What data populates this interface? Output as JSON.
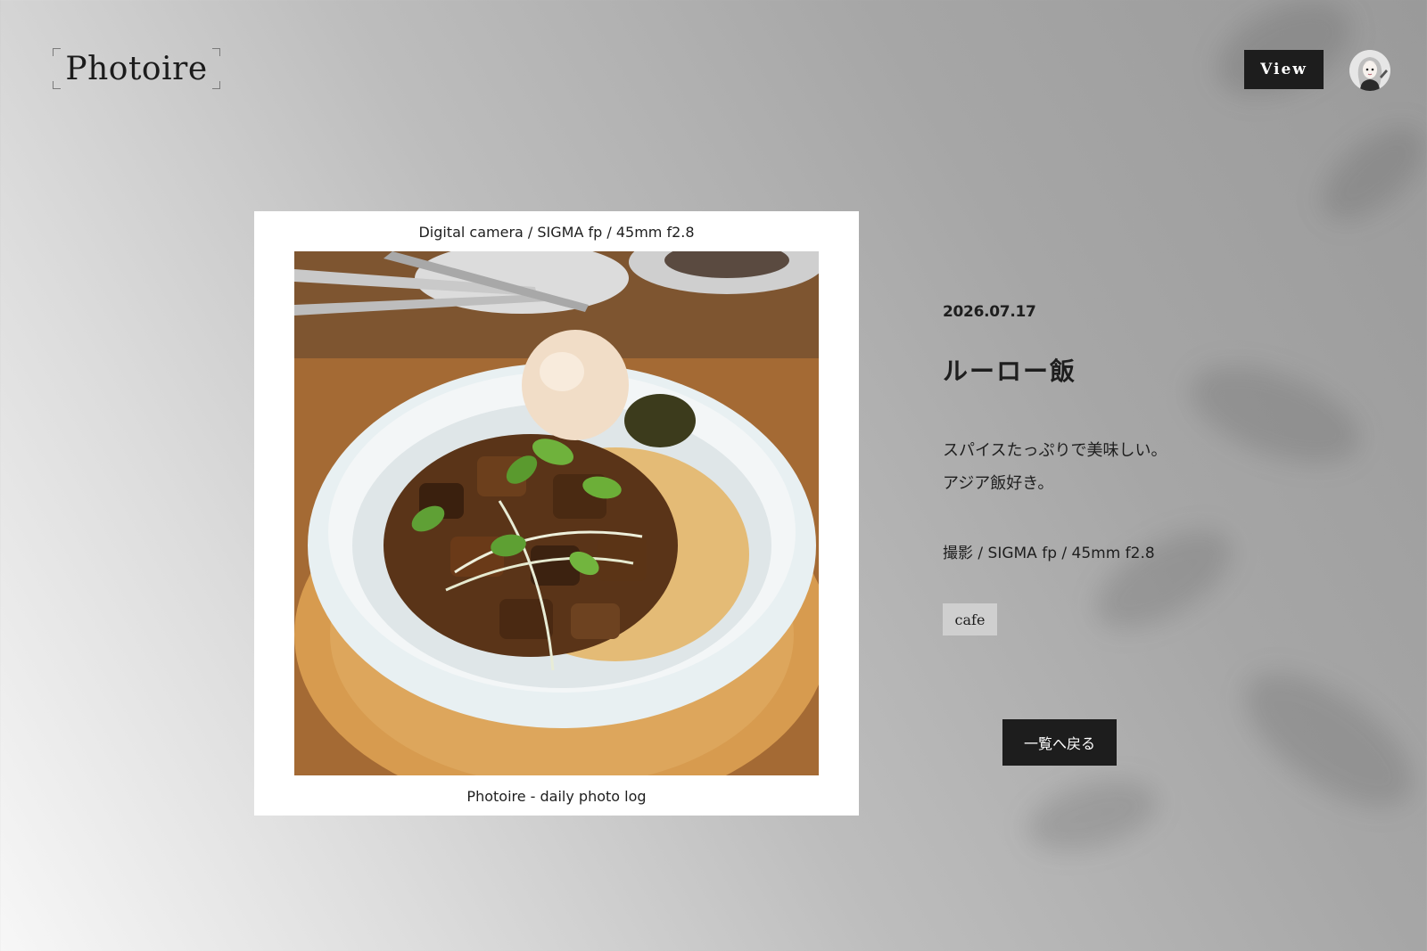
{
  "header": {
    "logo_text": "Photoire",
    "view_label": "View"
  },
  "photo": {
    "top_caption": "Digital camera / SIGMA fp / 45mm f2.8",
    "bottom_caption": "Photoire - daily photo log"
  },
  "post": {
    "date": "2026.07.17",
    "title": "ルーロー飯",
    "description": [
      "スパイスたっぷりで美味しい。",
      "アジア飯好き。"
    ],
    "meta": "撮影 / SIGMA fp / 45mm f2.8",
    "tag": "cafe"
  },
  "actions": {
    "back_label": "一覧へ戻る"
  }
}
